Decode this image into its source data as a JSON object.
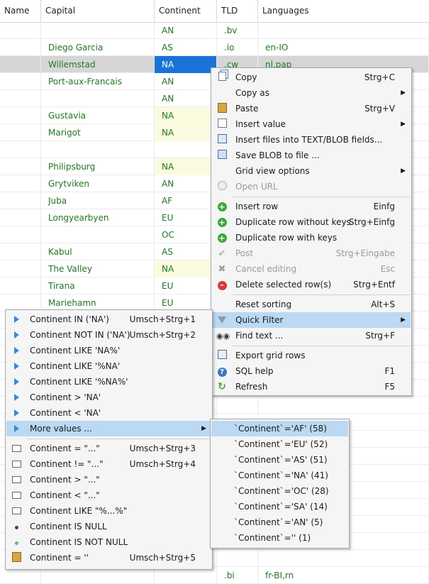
{
  "columns": [
    "Name",
    "Capital",
    "Continent",
    "TLD",
    "Languages"
  ],
  "rows": [
    {
      "capital": "",
      "continent": "AN",
      "tld": ".bv",
      "languages": ""
    },
    {
      "capital": "Diego Garcia",
      "continent": "AS",
      "tld": ".io",
      "languages": "en-IO"
    },
    {
      "capital": "Willemstad",
      "continent": "NA",
      "tld": ".cw",
      "languages": "nl,pap"
    },
    {
      "capital": "Port-aux-Francais",
      "continent": "AN",
      "tld": "",
      "languages": ""
    },
    {
      "capital": "",
      "continent": "AN",
      "tld": "",
      "languages": ""
    },
    {
      "capital": "Gustavia",
      "continent": "NA",
      "tld": "",
      "languages": ""
    },
    {
      "capital": "Marigot",
      "continent": "NA",
      "tld": "",
      "languages": ""
    },
    {
      "capital": "",
      "continent": "",
      "tld": "",
      "languages": ""
    },
    {
      "capital": "Philipsburg",
      "continent": "NA",
      "tld": "",
      "languages": ""
    },
    {
      "capital": "Grytviken",
      "continent": "AN",
      "tld": "",
      "languages": ""
    },
    {
      "capital": "Juba",
      "continent": "AF",
      "tld": "",
      "languages": ""
    },
    {
      "capital": "Longyearbyen",
      "continent": "EU",
      "tld": "",
      "languages": ""
    },
    {
      "capital": "",
      "continent": "OC",
      "tld": "",
      "languages": ""
    },
    {
      "capital": "Kabul",
      "continent": "AS",
      "tld": "",
      "languages": ""
    },
    {
      "capital": "The Valley",
      "continent": "NA",
      "tld": "",
      "languages": ""
    },
    {
      "capital": "Tirana",
      "continent": "EU",
      "tld": "",
      "languages": ""
    },
    {
      "capital": "Mariehamn",
      "continent": "EU",
      "tld": "",
      "languages": ""
    },
    {
      "capital": "",
      "continent": "",
      "tld": "",
      "languages": ""
    },
    {
      "capital": "",
      "continent": "",
      "tld": "",
      "languages": ""
    },
    {
      "capital": "",
      "continent": "",
      "tld": "",
      "languages": ""
    },
    {
      "capital": "",
      "continent": "",
      "tld": "",
      "languages": ""
    },
    {
      "capital": "",
      "continent": "",
      "tld": "",
      "languages": ""
    },
    {
      "capital": "",
      "continent": "",
      "tld": "",
      "languages": ""
    },
    {
      "capital": "",
      "continent": "",
      "tld": ".am",
      "languages": "hy"
    },
    {
      "capital": "",
      "continent": "",
      "tld": "",
      "languages": ""
    },
    {
      "capital": "",
      "continent": "",
      "tld": "",
      "languages": ""
    },
    {
      "capital": "",
      "continent": "",
      "tld": "",
      "languages": ""
    },
    {
      "capital": "",
      "continent": "",
      "tld": "",
      "languages": ""
    },
    {
      "capital": "",
      "continent": "",
      "tld": "",
      "languages": ""
    },
    {
      "capital": "",
      "continent": "",
      "tld": "",
      "languages": ""
    },
    {
      "capital": "",
      "continent": "",
      "tld": "",
      "languages": ""
    },
    {
      "capital": "",
      "continent": "",
      "tld": "",
      "languages": ""
    },
    {
      "capital": "",
      "continent": "",
      "tld": ".bi",
      "languages": "fr-BI,rn"
    }
  ],
  "context_menu": [
    {
      "label": "Copy",
      "shortcut": "Strg+C",
      "icon": "copy-icon"
    },
    {
      "label": "Copy as",
      "shortcut": "",
      "icon": "",
      "submenu": true
    },
    {
      "label": "Paste",
      "shortcut": "Strg+V",
      "icon": "paste-icon"
    },
    {
      "label": "Insert value",
      "shortcut": "",
      "icon": "insert-value-icon",
      "submenu": true
    },
    {
      "label": "Insert files into TEXT/BLOB fields...",
      "shortcut": "",
      "icon": "insert-files-icon"
    },
    {
      "label": "Save BLOB to file ...",
      "shortcut": "",
      "icon": "save-icon"
    },
    {
      "label": "Grid view options",
      "shortcut": "",
      "icon": "",
      "submenu": true
    },
    {
      "label": "Open URL",
      "shortcut": "",
      "icon": "globe-icon",
      "disabled": true
    },
    {
      "sep": true
    },
    {
      "label": "Insert row",
      "shortcut": "Einfg",
      "icon": "add-icon"
    },
    {
      "label": "Duplicate row without keys",
      "shortcut": "Strg+Einfg",
      "icon": "add-icon"
    },
    {
      "label": "Duplicate row with keys",
      "shortcut": "",
      "icon": "add-icon"
    },
    {
      "label": "Post",
      "shortcut": "Strg+Eingabe",
      "icon": "check-icon",
      "disabled": true
    },
    {
      "label": "Cancel editing",
      "shortcut": "Esc",
      "icon": "cancel-icon",
      "disabled": true
    },
    {
      "label": "Delete selected row(s)",
      "shortcut": "Strg+Entf",
      "icon": "delete-icon"
    },
    {
      "sep": true
    },
    {
      "label": "Reset sorting",
      "shortcut": "Alt+S",
      "icon": ""
    },
    {
      "label": "Quick Filter",
      "shortcut": "",
      "icon": "filter-icon",
      "submenu": true,
      "hot": true
    },
    {
      "label": "Find text ...",
      "shortcut": "Strg+F",
      "icon": "binoculars-icon"
    },
    {
      "sep": true
    },
    {
      "label": "Export grid rows",
      "shortcut": "",
      "icon": "export-icon"
    },
    {
      "label": "SQL help",
      "shortcut": "F1",
      "icon": "help-icon"
    },
    {
      "label": "Refresh",
      "shortcut": "F5",
      "icon": "refresh-icon"
    }
  ],
  "quick_filter_menu": [
    {
      "label": "Continent IN ('NA')",
      "shortcut": "Umsch+Strg+1",
      "icon": "triangle"
    },
    {
      "label": "Continent NOT IN ('NA')",
      "shortcut": "Umsch+Strg+2",
      "icon": "triangle"
    },
    {
      "label": "Continent LIKE 'NA%'",
      "shortcut": "",
      "icon": "triangle"
    },
    {
      "label": "Continent LIKE '%NA'",
      "shortcut": "",
      "icon": "triangle"
    },
    {
      "label": "Continent LIKE '%NA%'",
      "shortcut": "",
      "icon": "triangle"
    },
    {
      "label": "Continent > 'NA'",
      "shortcut": "",
      "icon": "triangle"
    },
    {
      "label": "Continent < 'NA'",
      "shortcut": "",
      "icon": "triangle"
    },
    {
      "label": "More values ...",
      "shortcut": "",
      "icon": "triangle",
      "submenu": true,
      "hot": true
    },
    {
      "sep": true
    },
    {
      "label": "Continent = \"...\"",
      "shortcut": "Umsch+Strg+3",
      "icon": "box"
    },
    {
      "label": "Continent != \"...\"",
      "shortcut": "Umsch+Strg+4",
      "icon": "box"
    },
    {
      "label": "Continent > \"...\"",
      "shortcut": "",
      "icon": "box"
    },
    {
      "label": "Continent < \"...\"",
      "shortcut": "",
      "icon": "box"
    },
    {
      "label": "Continent LIKE \"%...%\"",
      "shortcut": "",
      "icon": "box"
    },
    {
      "label": "Continent IS NULL",
      "shortcut": "",
      "icon": "dot-dark"
    },
    {
      "label": "Continent IS NOT NULL",
      "shortcut": "",
      "icon": "dot-green"
    },
    {
      "label": "Continent = ''",
      "shortcut": "Umsch+Strg+5",
      "icon": "paste-icon"
    }
  ],
  "more_values_menu": [
    {
      "label": "`Continent`='AF' (58)",
      "hot": true
    },
    {
      "label": "`Continent`='EU' (52)"
    },
    {
      "label": "`Continent`='AS' (51)"
    },
    {
      "label": "`Continent`='NA' (41)"
    },
    {
      "label": "`Continent`='OC' (28)"
    },
    {
      "label": "`Continent`='SA' (14)"
    },
    {
      "label": "`Continent`='AN' (5)"
    },
    {
      "label": "`Continent`='' (1)"
    }
  ],
  "colors": {
    "selection": "#1a73d8",
    "menu_hot": "#bcd9f3",
    "data_text": "#1e7a1e"
  }
}
